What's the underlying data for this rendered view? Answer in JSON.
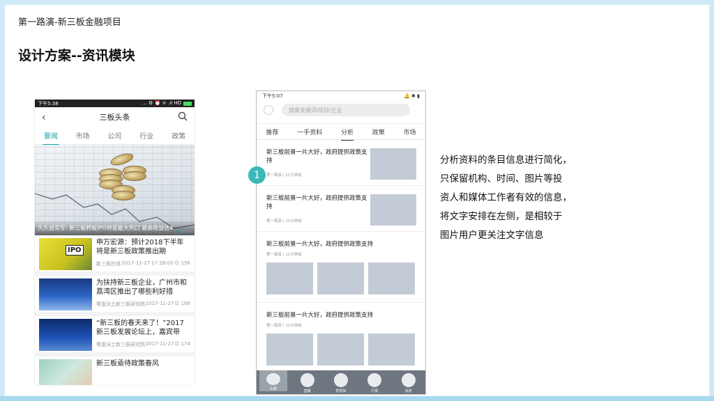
{
  "breadcrumb": "第一路演-新三板金融项目",
  "page_title": "设计方案--资讯模块",
  "colors": {
    "accent": "#1aa5a6",
    "badge": "#3cb8b9",
    "placeholder_gray": "#c3ccd6",
    "tabbar": "#6e7680",
    "frame": "#cfeaf6"
  },
  "phone1": {
    "status_time": "下午5:38",
    "status_icons": "... ⚙ ⏰ ᯤ .ıl HD",
    "header_title": "三板头条",
    "tabs": [
      "要闻",
      "市场",
      "公司",
      "行业",
      "政策"
    ],
    "active_tab": 0,
    "banner_caption": "久久益实军: 新三板转板IPO将是最大风口 最高收益达4",
    "news": [
      {
        "title": "申万宏源：预计2018下半年将是新三板政策推出期",
        "source": "新三板在线",
        "time": "2017-11-27 17:28:00",
        "count": "156"
      },
      {
        "title": "为扶持新三板企业，广州市和荔湾区推出了哪些利好措",
        "source": "零壹沃土新三板研究院",
        "time": "2017-11-27",
        "count": "166"
      },
      {
        "title": "“新三板的春天来了！”2017新三板发展论坛上，嘉宾带",
        "source": "零壹沃土新三板研究院",
        "time": "2017-11-27",
        "count": "174"
      },
      {
        "title": "新三板亟待政策春风"
      }
    ]
  },
  "phone2": {
    "status_time": "下午5:07",
    "search_placeholder": "搜索关键词/项目/企业",
    "tabs": [
      "推荐",
      "一手资料",
      "分析",
      "政策",
      "市场"
    ],
    "active_tab": 2,
    "items": [
      {
        "title": "新三板前景一片大好，政府提供政策支持",
        "meta": "第一路演 | 11分钟前"
      },
      {
        "title": "新三板前景一片大好，政府提供政策支持",
        "meta": "第一路演 | 11分钟前"
      },
      {
        "title": "新三板前景一片大好，政府提供政策支持",
        "meta": "第一路演 | 11分钟前"
      },
      {
        "title": "新三板前景一片大好，政府提供政策支持",
        "meta": "第一路演 | 11分钟前"
      }
    ],
    "tabbar": [
      "头条",
      "直播",
      "优项目",
      "行情",
      "消息"
    ]
  },
  "badge_number": "1",
  "description_lines": [
    "分析资料的条目信息进行简化，",
    "只保留机构、时间、图片等投",
    "资人和媒体工作者有效的信息，",
    "将文字安排在左侧，是相较于",
    "图片用户更关注文字信息"
  ]
}
